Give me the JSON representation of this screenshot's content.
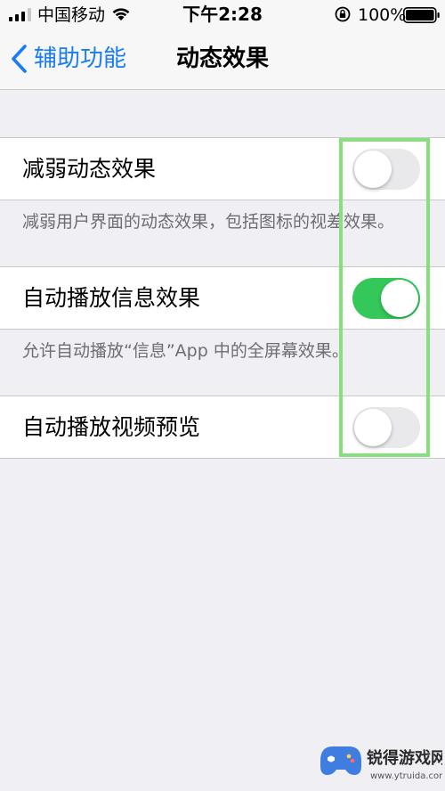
{
  "status_bar": {
    "carrier": "中国移动",
    "time": "下午2:28",
    "battery": "100%"
  },
  "nav": {
    "back_label": "辅助功能",
    "title": "动态效果"
  },
  "settings": [
    {
      "label": "减弱动态效果",
      "on": false,
      "footer": "减弱用户界面的动态效果，包括图标的视差效果。"
    },
    {
      "label": "自动播放信息效果",
      "on": true,
      "footer": "允许自动播放“信息”App 中的全屏幕效果。"
    },
    {
      "label": "自动播放视频预览",
      "on": false
    }
  ],
  "colors": {
    "accent": "#1a7cf5",
    "switch_on": "#34c759",
    "switch_off": "#e9e9eb",
    "highlight": "#86e07c"
  },
  "watermark": {
    "brand": "锐得游戏网",
    "url": "www.ytruida.com"
  }
}
